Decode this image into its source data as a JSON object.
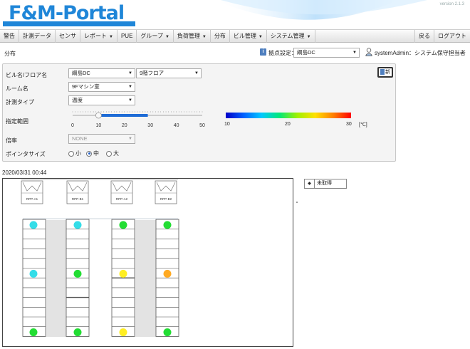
{
  "header": {
    "logo": "F&M-Portal",
    "version": "version 2.1.3"
  },
  "nav": {
    "left": [
      {
        "label": "警告",
        "has_caret": false
      },
      {
        "label": "計測データ",
        "has_caret": false
      },
      {
        "label": "センサ",
        "has_caret": false
      },
      {
        "label": "レポート",
        "has_caret": true
      },
      {
        "label": "PUE",
        "has_caret": false
      },
      {
        "label": "グループ",
        "has_caret": true
      },
      {
        "label": "負荷管理",
        "has_caret": true
      },
      {
        "label": "分布",
        "has_caret": false
      },
      {
        "label": "ビル管理",
        "has_caret": true
      },
      {
        "label": "システム管理",
        "has_caret": true
      }
    ],
    "right": [
      {
        "label": "戻る"
      },
      {
        "label": "ログアウト"
      }
    ]
  },
  "subbar": {
    "page_title": "分布",
    "site_icon_glyph": "i",
    "site_label": "拠点設定：",
    "site_value": "綱島DC",
    "user_label": "systemAdmin：システム保守担当者"
  },
  "panel": {
    "building_label": "ビル名/フロア名",
    "building_value": "綱島DC",
    "floor_value": "9階フロア",
    "room_label": "ルーム名",
    "room_value": "9Fマシン室",
    "measure_label": "計測タイプ",
    "measure_value": "温度",
    "range_label": "指定範囲",
    "range_ticks": [
      "0",
      "10",
      "20",
      "30",
      "40",
      "50"
    ],
    "range_selected": [
      10,
      29
    ],
    "range_max": 50,
    "color_ticks": [
      "10",
      "20",
      "30"
    ],
    "unit": "[℃]",
    "scale_label": "倍率",
    "scale_value": "NONE",
    "pointer_label": "ポインタサイズ",
    "pointer_options": [
      {
        "label": "小",
        "selected": false
      },
      {
        "label": "中",
        "selected": true
      },
      {
        "label": "大",
        "selected": false
      }
    ],
    "update_button": "新",
    "accent": "#1e6cd6"
  },
  "timestamp": "2020/03/31 00:44",
  "floor": {
    "units": [
      {
        "label": "RPP-A1"
      },
      {
        "label": "RPP-B1"
      },
      {
        "label": "RPP-A2"
      },
      {
        "label": "RPP-B2"
      }
    ],
    "sensors": [
      {
        "rack": 0,
        "row": 0,
        "color": "#33dde8"
      },
      {
        "rack": 0,
        "row": 5,
        "color": "#33dde8"
      },
      {
        "rack": 0,
        "row": 11,
        "color": "#22dd33"
      },
      {
        "rack": 1,
        "row": 0,
        "color": "#33dde8"
      },
      {
        "rack": 1,
        "row": 5,
        "color": "#22dd33"
      },
      {
        "rack": 1,
        "row": 11,
        "color": "#22dd33"
      },
      {
        "rack": 2,
        "row": 0,
        "color": "#22dd33"
      },
      {
        "rack": 2,
        "row": 5,
        "color": "#ffee22"
      },
      {
        "rack": 2,
        "row": 11,
        "color": "#ffee22"
      },
      {
        "rack": 3,
        "row": 0,
        "color": "#22dd33"
      },
      {
        "rack": 3,
        "row": 5,
        "color": "#ffaa22"
      },
      {
        "rack": 3,
        "row": 11,
        "color": "#22dd33"
      }
    ]
  },
  "legend": {
    "checkbox_glyph": "◆",
    "label": "未取得"
  }
}
